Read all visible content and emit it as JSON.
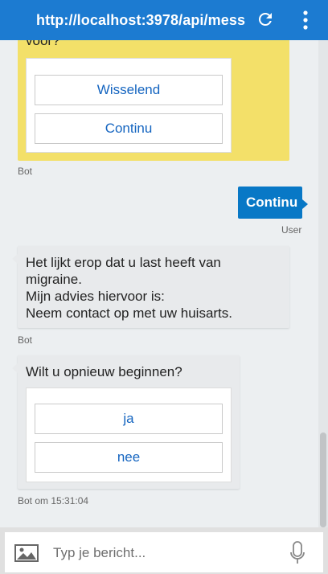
{
  "header": {
    "title": "http://localhost:3978/api/mess",
    "background_color": "#1c7bd1",
    "refresh_icon": "refresh-icon",
    "menu_icon": "more-vert-icon"
  },
  "messages": {
    "first_card": {
      "partial_text": "voor?",
      "buttons": [
        "Wisselend",
        "Continu"
      ],
      "sender": "Bot",
      "bubble_color": "#f3e069"
    },
    "user_message": {
      "text": "Continu",
      "sender": "User",
      "bubble_color": "#0878c6"
    },
    "bot_advice": {
      "lines": [
        "Het lijkt erop dat u last heeft van",
        "migraine.",
        "Mijn advies hiervoor is:",
        "Neem contact op met uw huisarts."
      ],
      "sender": "Bot"
    },
    "restart_card": {
      "text": "Wilt u opnieuw beginnen?",
      "buttons": [
        "ja",
        "nee"
      ],
      "sender_time": "Bot om 15:31:04"
    }
  },
  "input": {
    "placeholder": "Typ je bericht...",
    "value": "",
    "image_icon": "image-upload-icon",
    "mic_icon": "microphone-icon"
  }
}
